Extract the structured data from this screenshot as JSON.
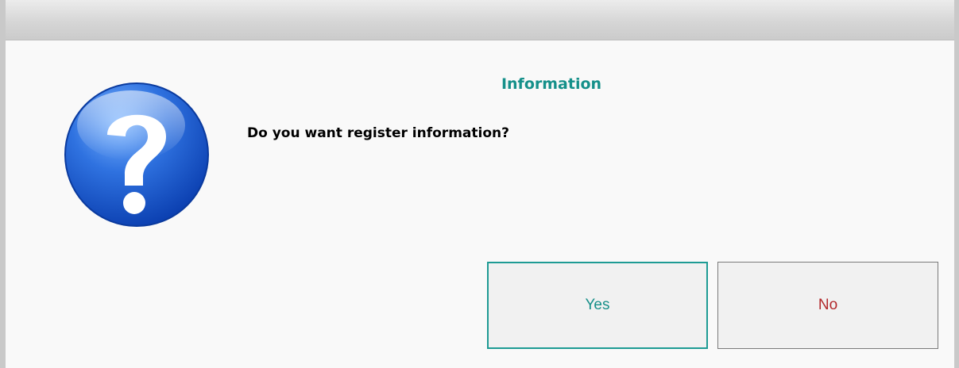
{
  "dialog": {
    "title": "Information",
    "message": "Do you want register information?",
    "icon": "question-icon",
    "title_color": "#15908a"
  },
  "buttons": {
    "yes_label": "Yes",
    "no_label": "No",
    "yes_color": "#178f89",
    "no_color": "#b2282b"
  }
}
